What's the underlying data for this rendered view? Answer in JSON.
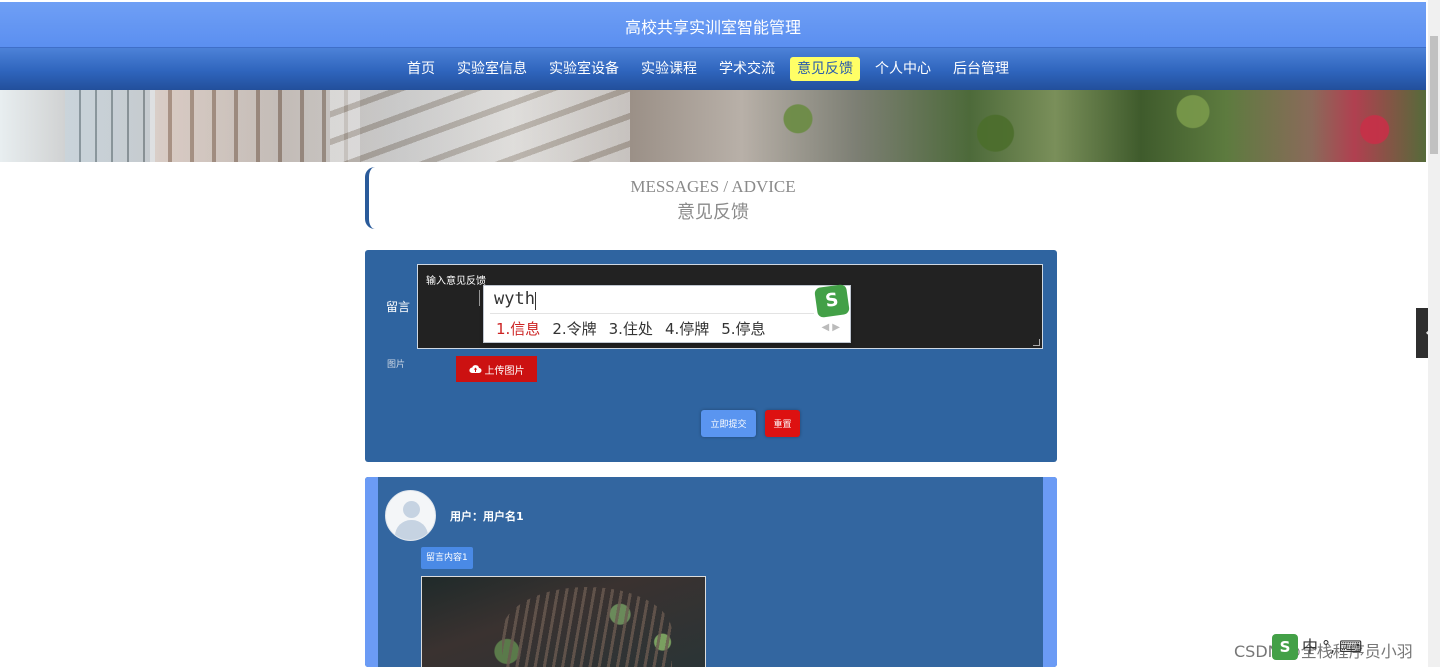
{
  "header": {
    "site_title": "高校共享实训室智能管理"
  },
  "nav": {
    "items": [
      {
        "label": "首页"
      },
      {
        "label": "实验室信息"
      },
      {
        "label": "实验室设备"
      },
      {
        "label": "实验课程"
      },
      {
        "label": "学术交流"
      },
      {
        "label": "意见反馈",
        "active": true
      },
      {
        "label": "个人中心"
      },
      {
        "label": "后台管理"
      }
    ]
  },
  "section": {
    "title_en": "MESSAGES / ADVICE",
    "title_cn": "意见反馈"
  },
  "form": {
    "message_label": "留言",
    "message_placeholder": "输入意见反馈",
    "image_label": "图片",
    "upload_label": "上传图片",
    "submit_label": "立即提交",
    "reset_label": "重置"
  },
  "ime": {
    "composition": "wyth",
    "candidates": [
      "1.信息",
      "2.令牌",
      "3.住处",
      "4.停牌",
      "5.停息"
    ],
    "logo": "S"
  },
  "message_item": {
    "user_line": "用户：用户名1",
    "content": "留言内容1"
  },
  "side_tab": {
    "icon": "chevron-left-icon"
  },
  "watermark": {
    "text": "CSDN @全栈程序员小羽"
  },
  "colors": {
    "nav_active_bg": "#ffff66",
    "panel_bg": "#2f64a0",
    "accent": "#6b9bf5",
    "danger": "#dd1111"
  }
}
